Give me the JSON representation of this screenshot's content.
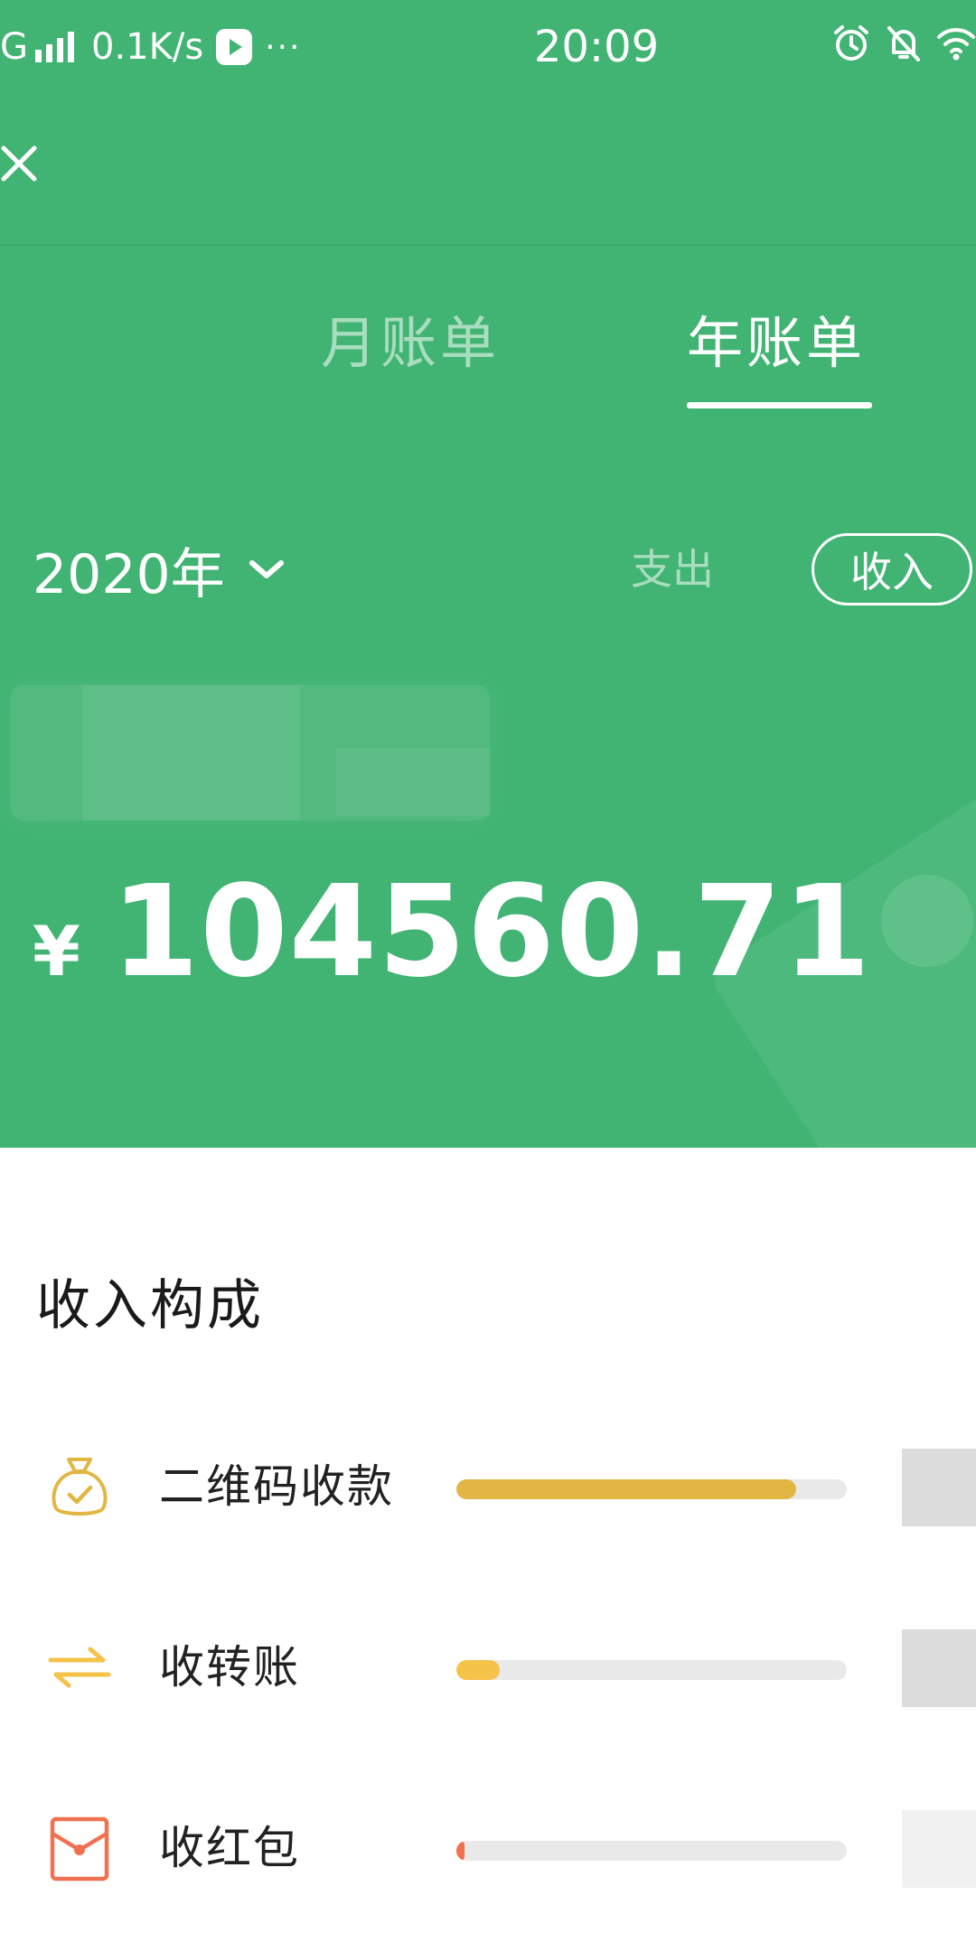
{
  "status_bar": {
    "network": "G",
    "speed": "0.1K/s",
    "more": "···",
    "time": "20:09"
  },
  "tabs": [
    {
      "label": "月账单",
      "active": false
    },
    {
      "label": "年账单",
      "active": true
    }
  ],
  "year_select": {
    "label": "2020年"
  },
  "type_toggle": {
    "expense": "支出",
    "income": "收入",
    "selected": "income"
  },
  "summary": {
    "currency": "¥",
    "amount": "104560.71"
  },
  "composition": {
    "title": "收入构成",
    "items": [
      {
        "label": "二维码收款",
        "icon": "money-bag-icon",
        "ratio": 0.87,
        "color": "#e2b642"
      },
      {
        "label": "收转账",
        "icon": "transfer-icon",
        "ratio": 0.11,
        "color": "#f6c34a"
      },
      {
        "label": "收红包",
        "icon": "red-envelope-icon",
        "ratio": 0.02,
        "color": "#f0704f"
      }
    ]
  },
  "colors": {
    "header_green": "#41b473",
    "white": "#ffffff",
    "track": "#e9e9e9"
  }
}
